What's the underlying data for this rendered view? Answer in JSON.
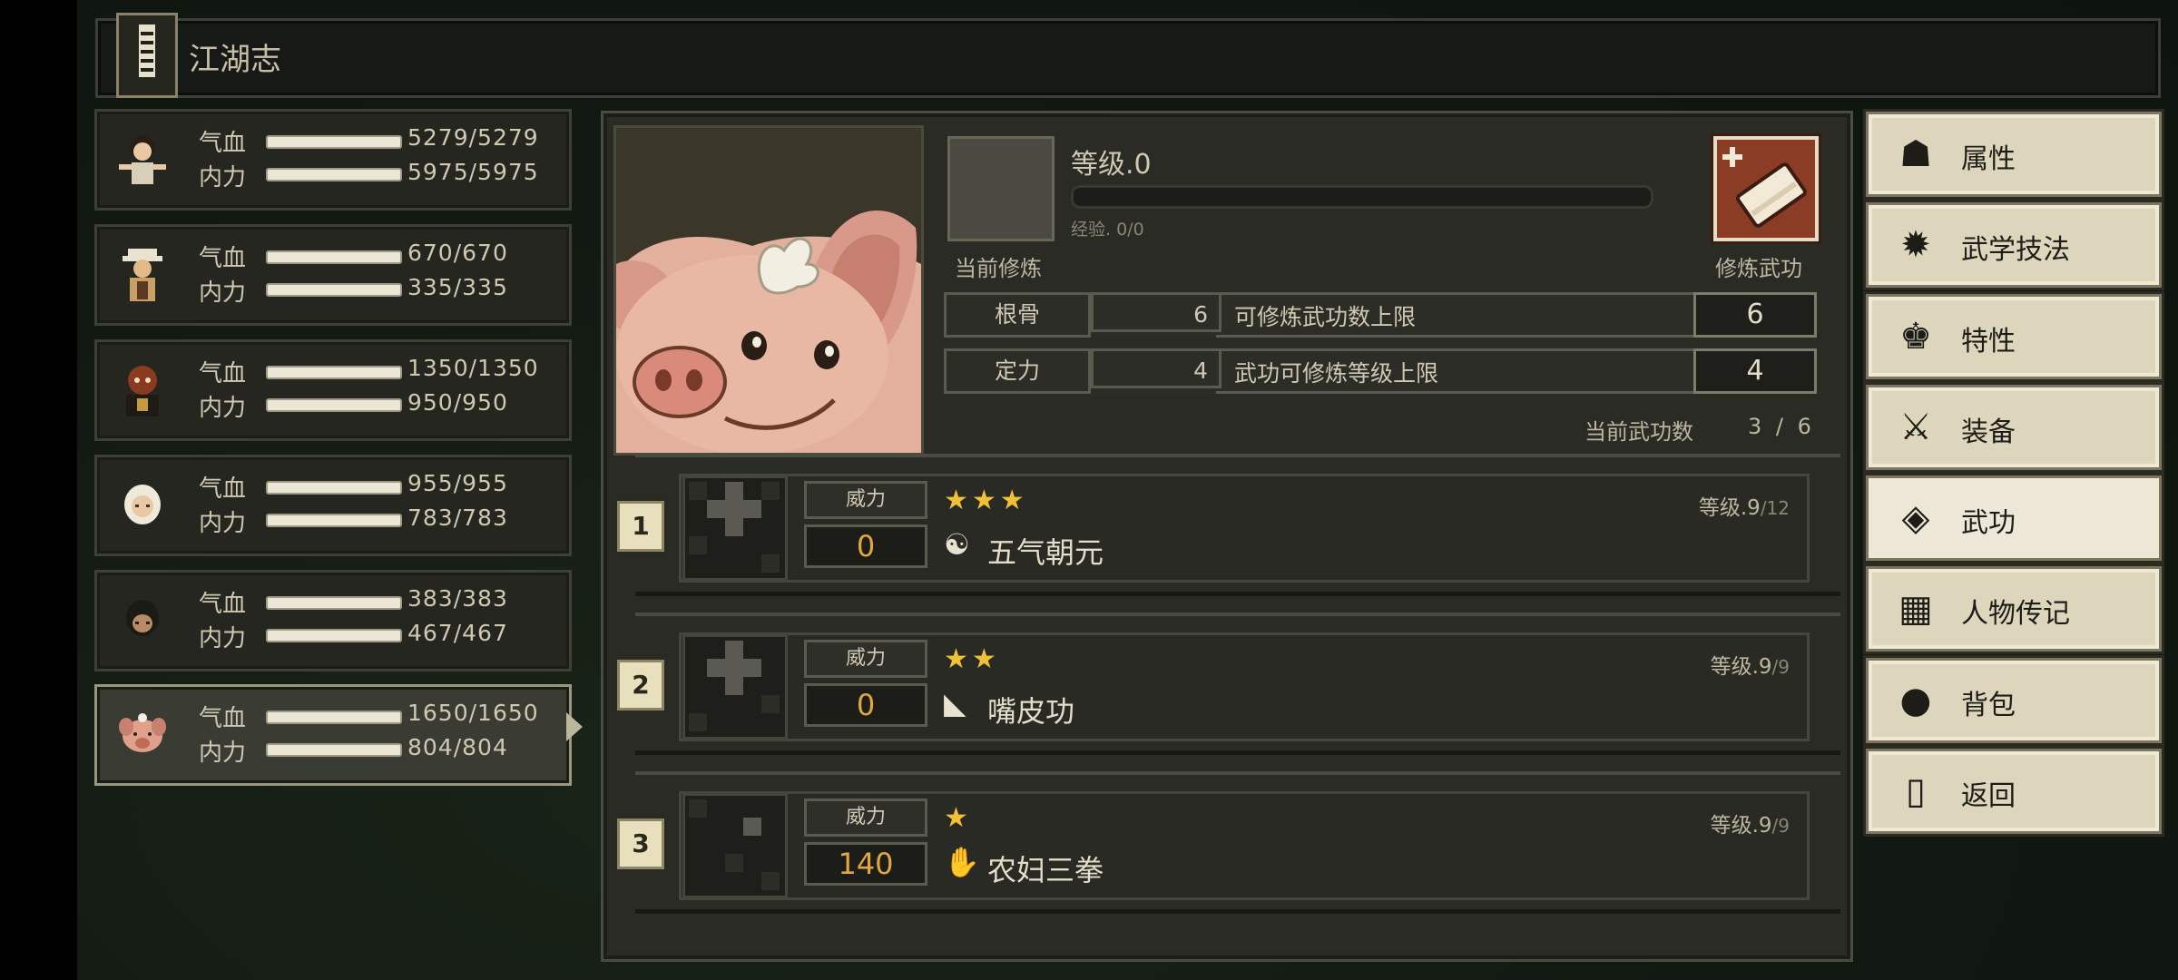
{
  "title": "江湖志",
  "characters": [
    {
      "hp_label": "气血",
      "hp": "5279/5279",
      "mp_label": "内力",
      "mp": "5975/5975"
    },
    {
      "hp_label": "气血",
      "hp": "670/670",
      "mp_label": "内力",
      "mp": "335/335"
    },
    {
      "hp_label": "气血",
      "hp": "1350/1350",
      "mp_label": "内力",
      "mp": "950/950"
    },
    {
      "hp_label": "气血",
      "hp": "955/955",
      "mp_label": "内力",
      "mp": "783/783"
    },
    {
      "hp_label": "气血",
      "hp": "383/383",
      "mp_label": "内力",
      "mp": "467/467"
    },
    {
      "hp_label": "气血",
      "hp": "1650/1650",
      "mp_label": "内力",
      "mp": "804/804"
    }
  ],
  "cultivation": {
    "level": "等级.0",
    "exp": "经验. 0/0",
    "current_label": "当前修炼",
    "learn_label": "修炼武功"
  },
  "attributes": [
    {
      "name": "根骨",
      "value": "6",
      "desc": "可修炼武功数上限",
      "limit": "6"
    },
    {
      "name": "定力",
      "value": "4",
      "desc": "武功可修炼等级上限",
      "limit": "4"
    }
  ],
  "skill_count": {
    "label": "当前武功数",
    "value": "3 / 6"
  },
  "skills": [
    {
      "slot": "1",
      "power_label": "威力",
      "power": "0",
      "stars": "★★★",
      "name": "五气朝元",
      "level": "等级.9",
      "level_max": "/12",
      "icon": "☯"
    },
    {
      "slot": "2",
      "power_label": "威力",
      "power": "0",
      "stars": "★★",
      "name": "嘴皮功",
      "level": "等级.9",
      "level_max": "/9",
      "icon": "◣"
    },
    {
      "slot": "3",
      "power_label": "威力",
      "power": "140",
      "stars": "★",
      "name": "农妇三拳",
      "level": "等级.9",
      "level_max": "/9",
      "icon": "✋"
    }
  ],
  "menu": [
    {
      "label": "属性",
      "icon": "person-icon"
    },
    {
      "label": "武学技法",
      "icon": "martial-arts-icon"
    },
    {
      "label": "特性",
      "icon": "trait-icon"
    },
    {
      "label": "装备",
      "icon": "sword-icon"
    },
    {
      "label": "武功",
      "icon": "skill-book-icon"
    },
    {
      "label": "人物传记",
      "icon": "biography-icon"
    },
    {
      "label": "背包",
      "icon": "bag-icon"
    },
    {
      "label": "返回",
      "icon": "door-icon"
    }
  ]
}
